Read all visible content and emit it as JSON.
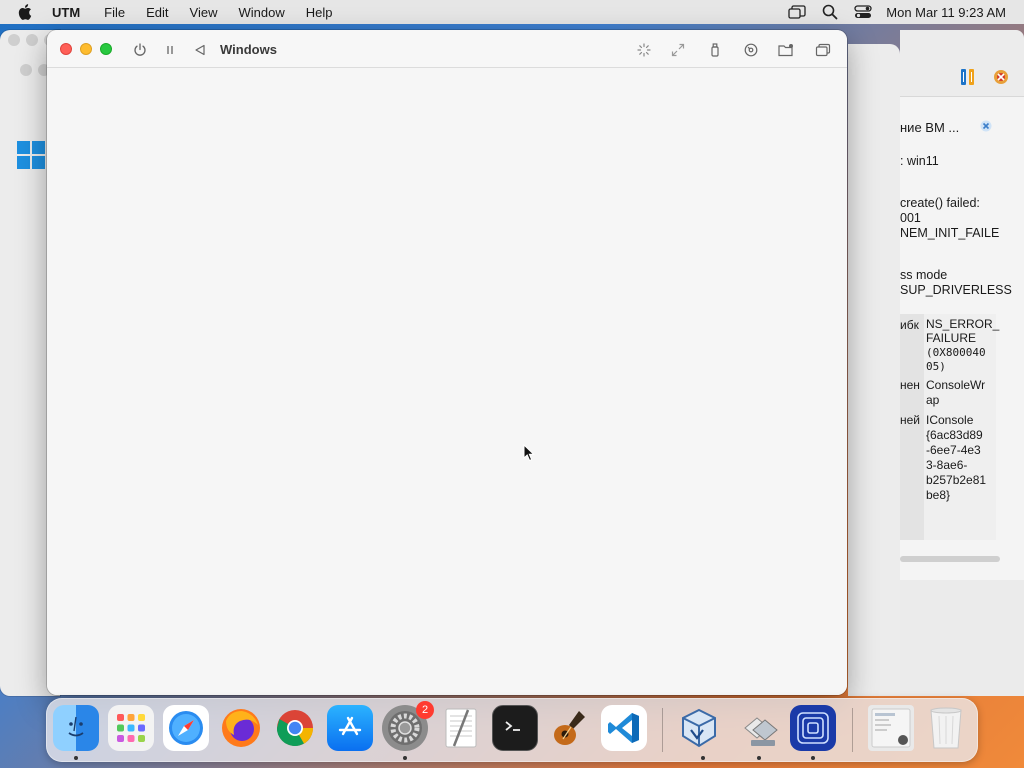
{
  "menubar": {
    "app_name": "UTM",
    "menus": [
      "File",
      "Edit",
      "View",
      "Window",
      "Help"
    ],
    "clock": "Mon Mar 11  9:23 AM"
  },
  "utm_window": {
    "title": "Windows"
  },
  "vbox_panel": {
    "title_fragment": "ние ВМ ...",
    "vm_line": ": win11",
    "error_lines": [
      "create() failed:",
      "001",
      "NEM_INIT_FAILE"
    ],
    "mode_lines": [
      "ss mode",
      "SUP_DRIVERLESS"
    ],
    "table": [
      {
        "key": "ибк",
        "value_lines": [
          "NS_ERROR_",
          "FAILURE",
          "(0X800040",
          "05)"
        ]
      },
      {
        "key": "нен",
        "value_lines": [
          "ConsoleWr",
          "ap"
        ]
      },
      {
        "key": "ней",
        "value_lines": [
          "IConsole",
          "{6ac83d89",
          "-6ee7-4e3",
          "3-8ae6-",
          "b257b2e81",
          "be8}"
        ]
      }
    ]
  },
  "dock": {
    "settings_badge": "2",
    "items": [
      "Finder",
      "Launchpad",
      "Safari",
      "Firefox",
      "Chrome",
      "App Store",
      "System Settings",
      "TextEdit",
      "Terminal",
      "GarageBand",
      "Visual Studio Code",
      "VirtualBox",
      "Migration Assistant",
      "UTM",
      "Downloads",
      "Trash"
    ]
  }
}
